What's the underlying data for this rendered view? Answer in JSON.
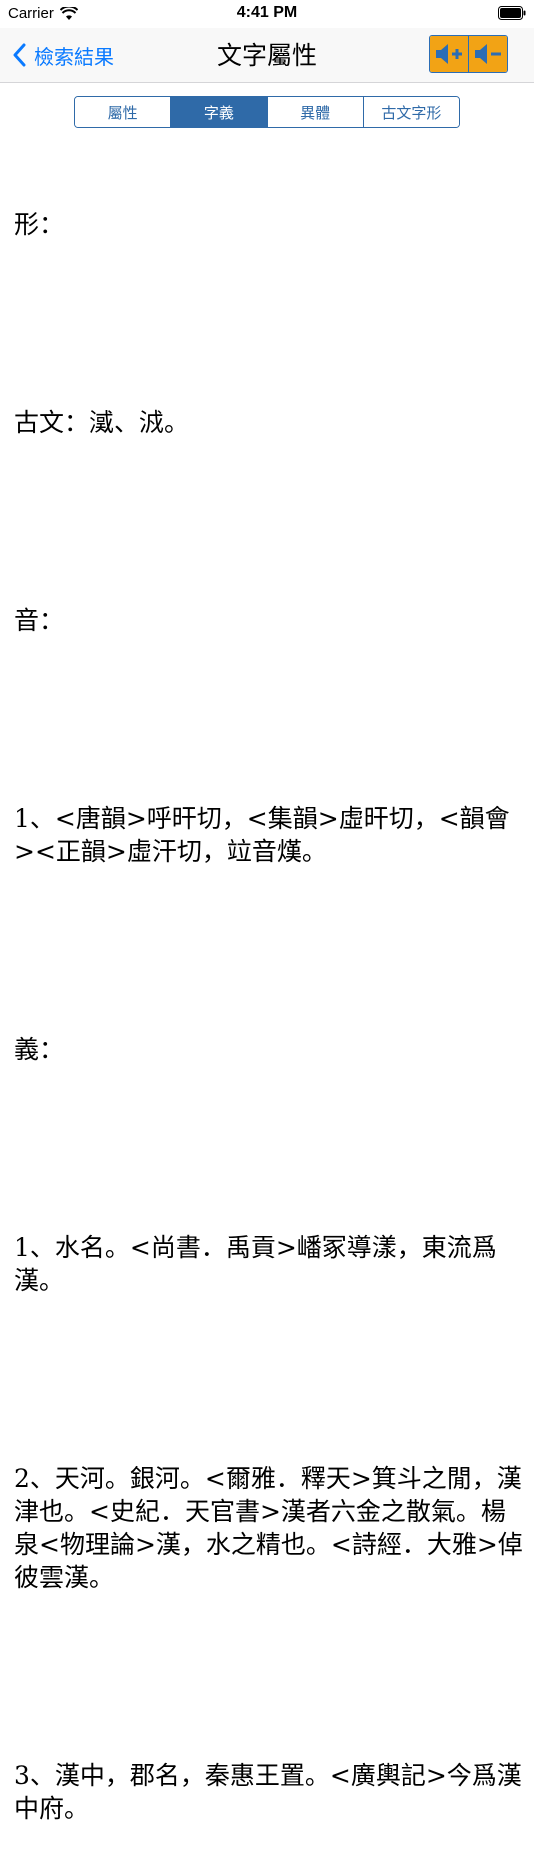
{
  "status": {
    "carrier": "Carrier",
    "time": "4:41 PM"
  },
  "nav": {
    "back_label": "檢索結果",
    "title": "文字屬性"
  },
  "tabs": [
    {
      "label": "屬性",
      "active": false
    },
    {
      "label": "字義",
      "active": true
    },
    {
      "label": "異體",
      "active": false
    },
    {
      "label": "古文字形",
      "active": false
    }
  ],
  "content": {
    "p1": "形：",
    "p2": "古文：㵄、㳚。",
    "p3": "音：",
    "p4": "1、<唐韻>呼旰切，<集韻>虛旰切，<韻會><正韻>虛汗切，竝音熯。",
    "p5": "義：",
    "p6": "1、水名。<尚書．禹貢>嶓冢導漾，東流爲漢。",
    "p7": "2、天河。銀河。<爾雅．釋天>箕斗之閒，漢津也。<史紀．天官書>漢者六金之散氣。楊泉<物理論>漢，水之精也。<詩經．大雅>倬彼雲漢。",
    "p8": "3、漢中，郡名，秦惠王置。<廣輿記>今爲漢中府。"
  },
  "colors": {
    "accent": "#0a7aff",
    "segment": "#2f6aa8",
    "volume": "#f2a315"
  }
}
